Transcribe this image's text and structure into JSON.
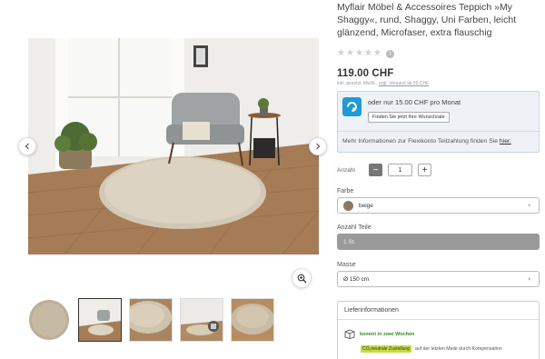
{
  "product": {
    "title": "Myflair Möbel & Accessoires Teppich »My Shaggy«, rund, Shaggy, Uni Farben, leicht glänzend, Microfaser, extra flauschig",
    "rating_stars": 0,
    "rating_max": 5,
    "price": "119.00 CHF",
    "vat_prefix": "inkl. gesetzl. MwSt.,",
    "vat_link": "zzgl. Versand ab 50 CHF"
  },
  "finance": {
    "monthly_text": "oder nur 15.00 CHF pro Monat",
    "button_label": "Finden Sie jetzt Ihre Wunschrate",
    "more_text": "Mehr Informationen zur Flexikonto Teilzahlung finden Sie",
    "more_link": "hier.",
    "brand_color": "#1e9bd7"
  },
  "quantity": {
    "label": "Anzahl",
    "minus": "−",
    "value": "1",
    "plus": "+"
  },
  "options": {
    "color_label": "Farbe",
    "color_value": "beige",
    "color_swatch": "#8b7762",
    "parts_label": "Anzahl Teile",
    "parts_value": "1 St.",
    "size_label": "Masse",
    "size_value": "Ø 150 cm"
  },
  "delivery": {
    "heading": "Lieferinformationen",
    "when": "kommt in zwei Wochen",
    "co2_badge": "CO₂neutrale Zustellung",
    "co2_text": "auf der letzten Meile durch Kompensation"
  },
  "icons": [
    "chevron-left-icon",
    "chevron-right-icon",
    "zoom-icon",
    "info-icon",
    "package-icon",
    "chevron-down-icon"
  ],
  "gallery": {
    "thumbnail_count": 5,
    "active_index": 1
  }
}
